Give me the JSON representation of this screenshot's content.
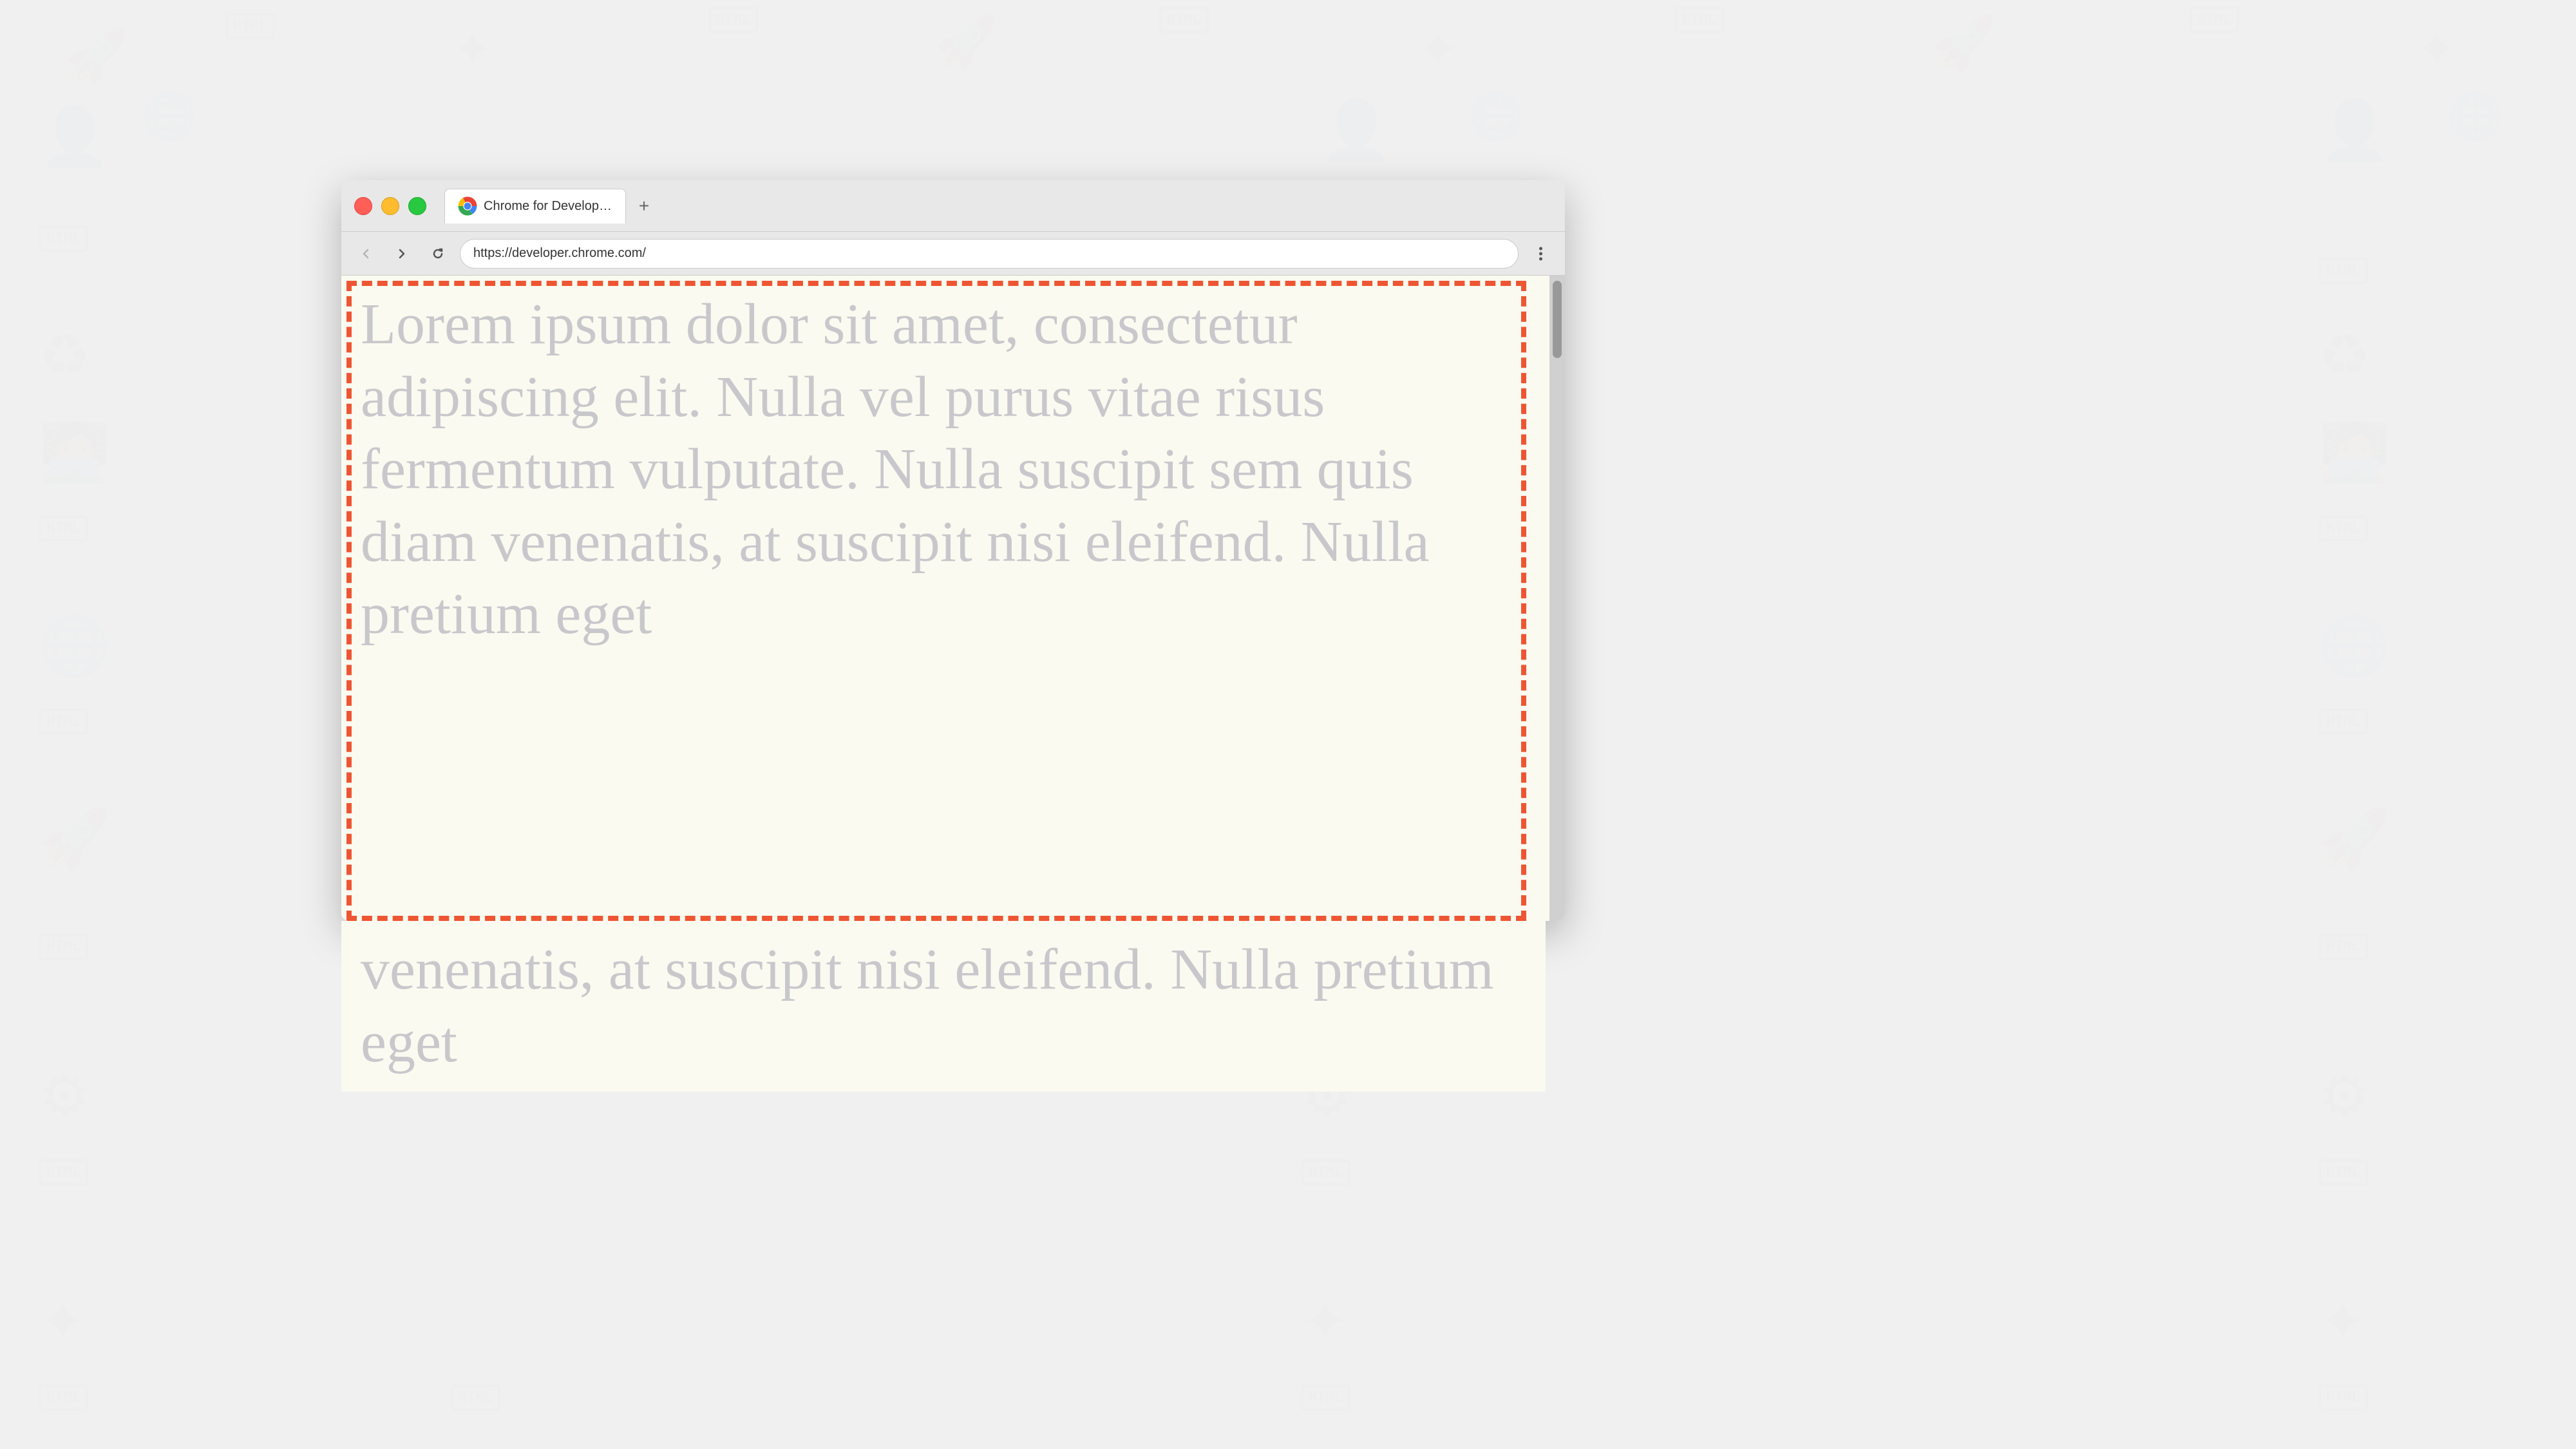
{
  "background": {
    "color": "#f0f0f0"
  },
  "browser": {
    "title_bar": {
      "tab_title": "Chrome for Developers",
      "tab_url": "https://developer.chrome.com/",
      "new_tab_label": "+"
    },
    "nav_bar": {
      "back_button": "←",
      "forward_button": "→",
      "reload_button": "↺",
      "address": "https://developer.chrome.com/",
      "menu_dots": "⋮"
    },
    "content": {
      "lorem_text": "Lorem ipsum dolor sit amet, consectetur adipiscing elit. Nulla vel purus vitae risus fermentum vulputate. Nulla suscipit sem quis diam venenatis, at suscipit nisi eleifend. Nulla pretium eget",
      "background_color": "#fafaf0",
      "border_color": "#ee3322"
    }
  }
}
